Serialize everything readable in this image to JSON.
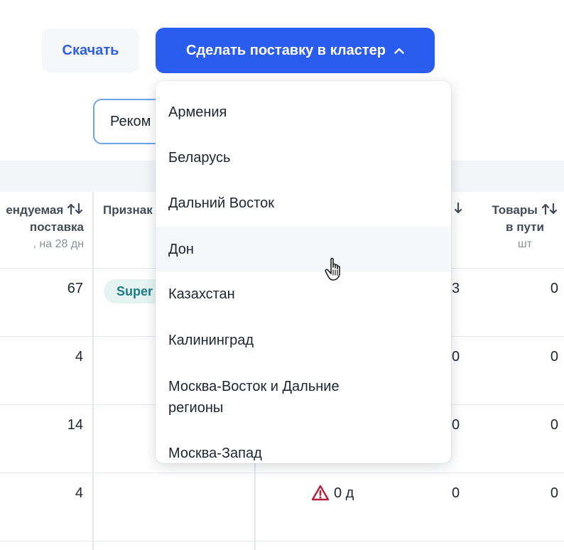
{
  "toolbar": {
    "download_label": "Скачать",
    "supply_label": "Сделать поставку в кластер",
    "filter_value": "Реком"
  },
  "table": {
    "headers": {
      "col1_line1": "ендуемая",
      "col1_line2": "поставка",
      "col1_sub": ", на 28 дн",
      "col2": "Признак",
      "col4_arrows": "↕",
      "col5_line1": "Товары",
      "col5_line2": "в пути",
      "col5_sub": "шт"
    },
    "badge": "Super",
    "rows": [
      {
        "col1": "67",
        "col4": "3",
        "col5": "0"
      },
      {
        "col1": "4",
        "col4": "0",
        "col5": "0"
      },
      {
        "col1": "14",
        "col4": "0",
        "col5": "0"
      },
      {
        "col1": "4",
        "col3": "0 д",
        "col4": "0",
        "col5": "0"
      }
    ]
  },
  "dropdown": {
    "items": [
      "Армения",
      "Беларусь",
      "Дальний Восток",
      "Дон",
      "Казахстан",
      "Калининград",
      "Москва-Восток и Дальние регионы",
      "Москва-Запад"
    ],
    "hovered_item": "Дон"
  },
  "colors": {
    "primary": "#2a5cf0",
    "badge_bg": "#e6f4f1",
    "badge_text": "#1d7a86",
    "warning": "#b3203c"
  },
  "icons": {
    "supply_chevron": "chevron-up-icon",
    "sort": "sort-arrows-icon",
    "warning": "warning-triangle-icon",
    "cursor": "hand-pointer-icon"
  }
}
